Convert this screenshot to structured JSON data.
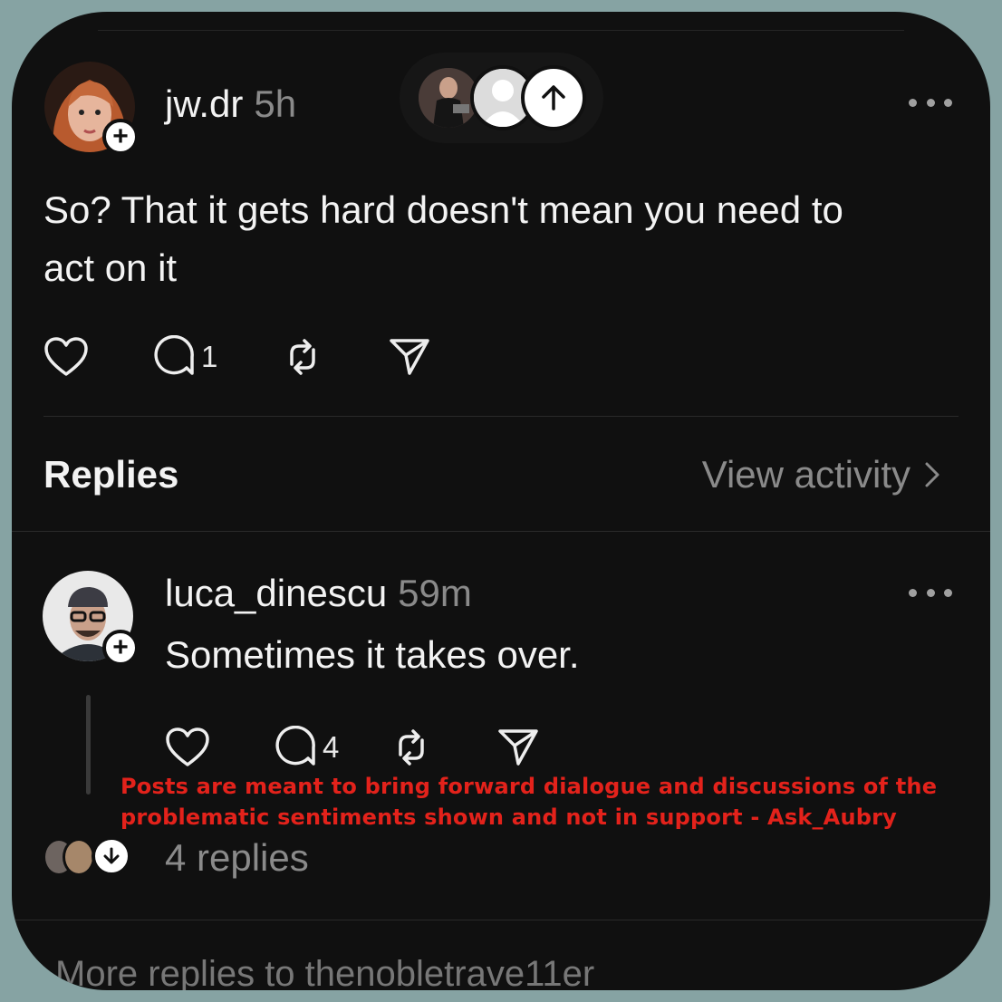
{
  "post": {
    "username": "jw.dr",
    "time": "5h",
    "text_line1": "So? That it gets hard doesn't mean you need to",
    "text_line2": "act on it",
    "reply_count": "1"
  },
  "replies_header": {
    "title": "Replies",
    "view_activity": "View activity"
  },
  "reply": {
    "username": "luca_dinescu",
    "time": "59m",
    "text": "Sometimes it takes over.",
    "reply_count": "4",
    "replies_link": "4 replies"
  },
  "disclaimer": {
    "line1": "Posts are meant to bring forward dialogue and discussions of the",
    "line2": "problematic sentiments shown and not in support - Ask_Aubry"
  },
  "more_replies": "More replies to thenobletrave11er",
  "colors": {
    "background": "#86a3a3",
    "card": "#101010",
    "disclaimer": "#e3221b"
  }
}
